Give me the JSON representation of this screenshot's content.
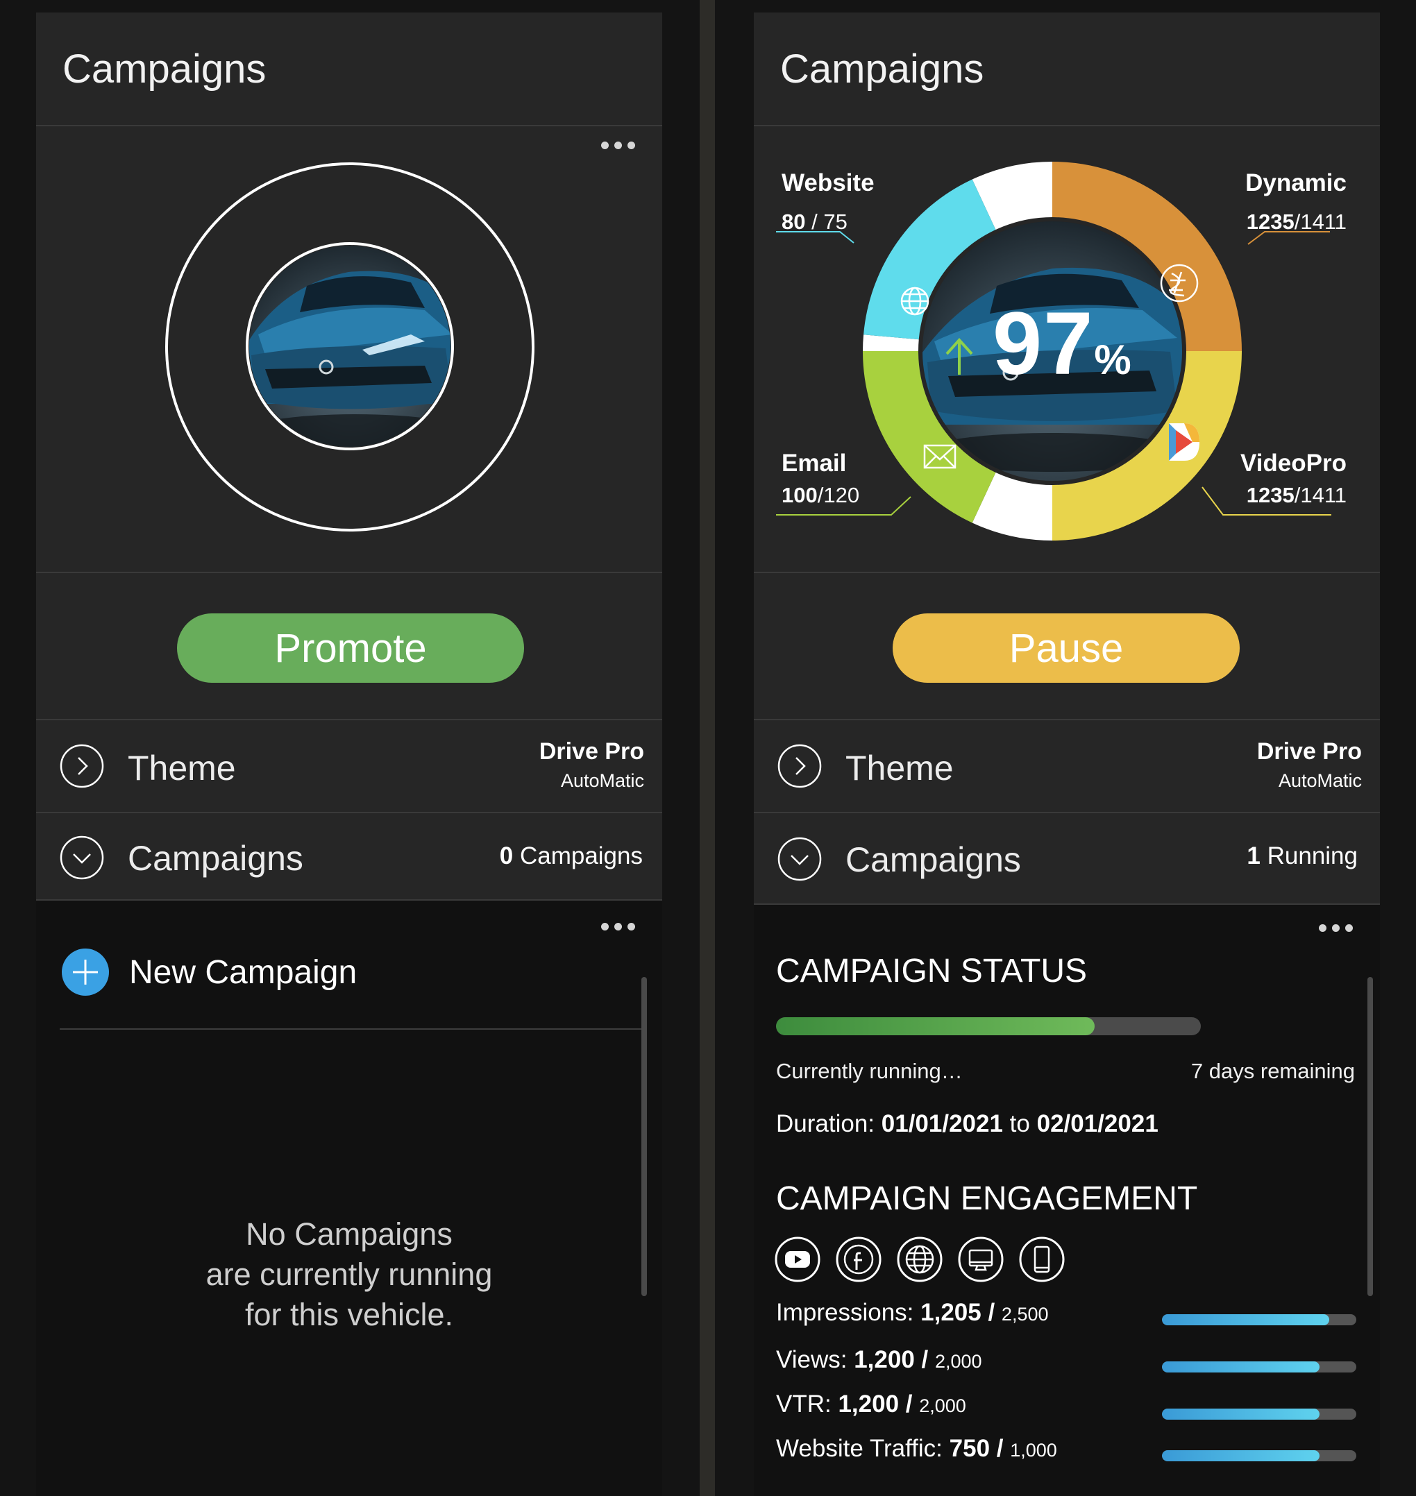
{
  "left_panel": {
    "title": "Campaigns",
    "promote_label": "Promote",
    "theme": {
      "label": "Theme",
      "name": "Drive Pro",
      "sub": "AutoMatic"
    },
    "campaigns": {
      "label": "Campaigns",
      "count_num": "0",
      "count_text": "Campaigns"
    },
    "new_campaign_label": "New Campaign",
    "empty_lines": [
      "No Campaigns",
      "are currently running",
      "for this vehicle."
    ]
  },
  "right_panel": {
    "title": "Campaigns",
    "pause_label": "Pause",
    "gauge": {
      "percent": "97",
      "percent_sign": "%",
      "website": {
        "name": "Website",
        "value": "80",
        "total": " / 75"
      },
      "dynamic": {
        "name": "Dynamic",
        "value": "1235",
        "total": "/1411"
      },
      "email": {
        "name": "Email",
        "value": "100",
        "total": "/120"
      },
      "videopro": {
        "name": "VideoPro",
        "value": "1235",
        "total": "/1411"
      }
    },
    "theme": {
      "label": "Theme",
      "name": "Drive Pro",
      "sub": "AutoMatic"
    },
    "campaigns": {
      "label": "Campaigns",
      "count_num": "1",
      "count_text": "Running"
    },
    "status": {
      "title": "CAMPAIGN STATUS",
      "progress": 0.75,
      "running_text": "Currently running…",
      "remaining_text": "7 days remaining",
      "duration_label": "Duration:",
      "start_date": "01/01/2021",
      "to_word": "to",
      "end_date": "02/01/2021"
    },
    "engagement": {
      "title": "CAMPAIGN ENGAGEMENT",
      "icons": [
        "youtube-icon",
        "facebook-icon",
        "globe-icon",
        "desktop-icon",
        "mobile-icon"
      ],
      "metrics": [
        {
          "label": "Impressions:",
          "value": "1,205",
          "sep": " / ",
          "total": "2,500",
          "fill": 0.86
        },
        {
          "label": "Views:",
          "value": "1,200",
          "sep": " / ",
          "total": "2,000",
          "fill": 0.81
        },
        {
          "label": "VTR:",
          "value": "1,200",
          "sep": " / ",
          "total": "2,000",
          "fill": 0.81
        },
        {
          "label": "Website Traffic:",
          "value": "750",
          "sep": " / ",
          "total": "1,000",
          "fill": 0.81
        }
      ]
    }
  },
  "colors": {
    "promote": "#68ad5b",
    "pause": "#ecbd4a",
    "website_segment": "#5fdcec",
    "dynamic_segment": "#d8913a",
    "videopro_segment": "#e8d44c",
    "email_segment": "#a8d13e",
    "gap_segment": "#ffffff",
    "new_campaign_accent": "#3aa1e4"
  }
}
